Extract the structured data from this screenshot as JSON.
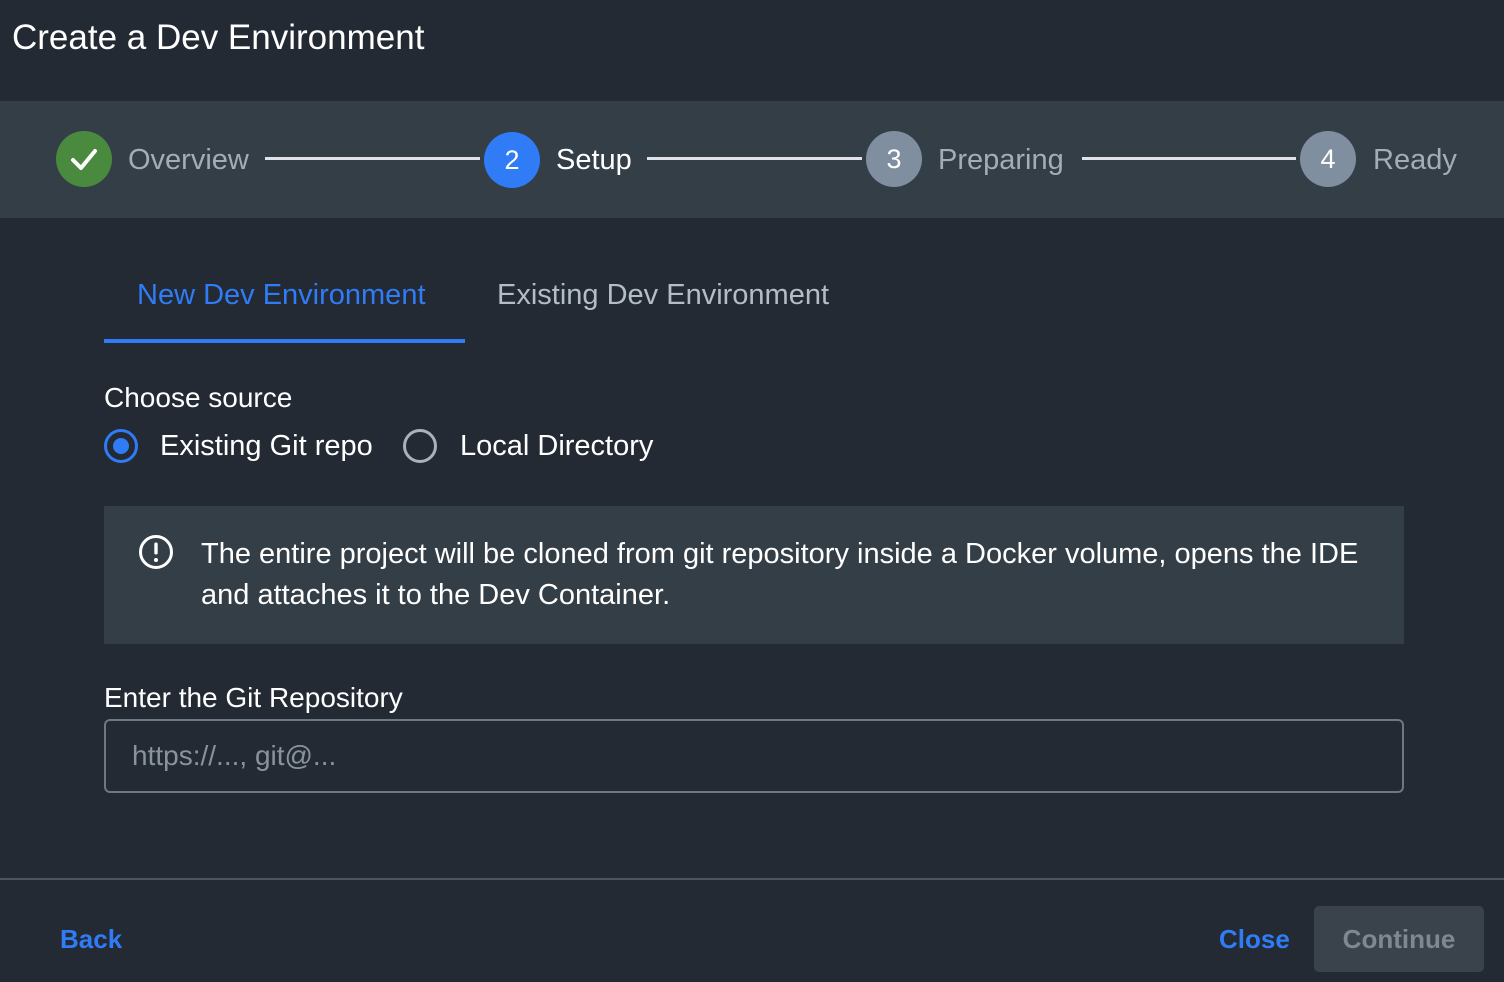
{
  "dialog": {
    "title": "Create a Dev Environment"
  },
  "stepper": {
    "steps": [
      {
        "number": "",
        "label": "Overview",
        "status": "completed",
        "icon": "check-icon"
      },
      {
        "number": "2",
        "label": "Setup",
        "status": "active"
      },
      {
        "number": "3",
        "label": "Preparing",
        "status": "pending"
      },
      {
        "number": "4",
        "label": "Ready",
        "status": "pending"
      }
    ]
  },
  "tabs": [
    {
      "label": "New Dev Environment",
      "selected": true
    },
    {
      "label": "Existing Dev Environment",
      "selected": false
    }
  ],
  "source": {
    "label": "Choose source",
    "options": [
      {
        "label": "Existing Git repo",
        "checked": true
      },
      {
        "label": "Local Directory",
        "checked": false
      }
    ]
  },
  "info": {
    "icon": "info-exclamation-icon",
    "text": "The entire project will be cloned from git repository inside a Docker volume, opens the IDE and attaches it to the Dev Container."
  },
  "repo": {
    "label": "Enter the Git Repository",
    "value": "",
    "placeholder": "https://..., git@..."
  },
  "footer": {
    "back_label": "Back",
    "close_label": "Close",
    "continue_label": "Continue",
    "continue_disabled": true
  },
  "colors": {
    "background": "#232a33",
    "band": "#343e47",
    "accent": "#2f7cf6",
    "success": "#4a8a3f",
    "pending": "#7f8fa0"
  }
}
